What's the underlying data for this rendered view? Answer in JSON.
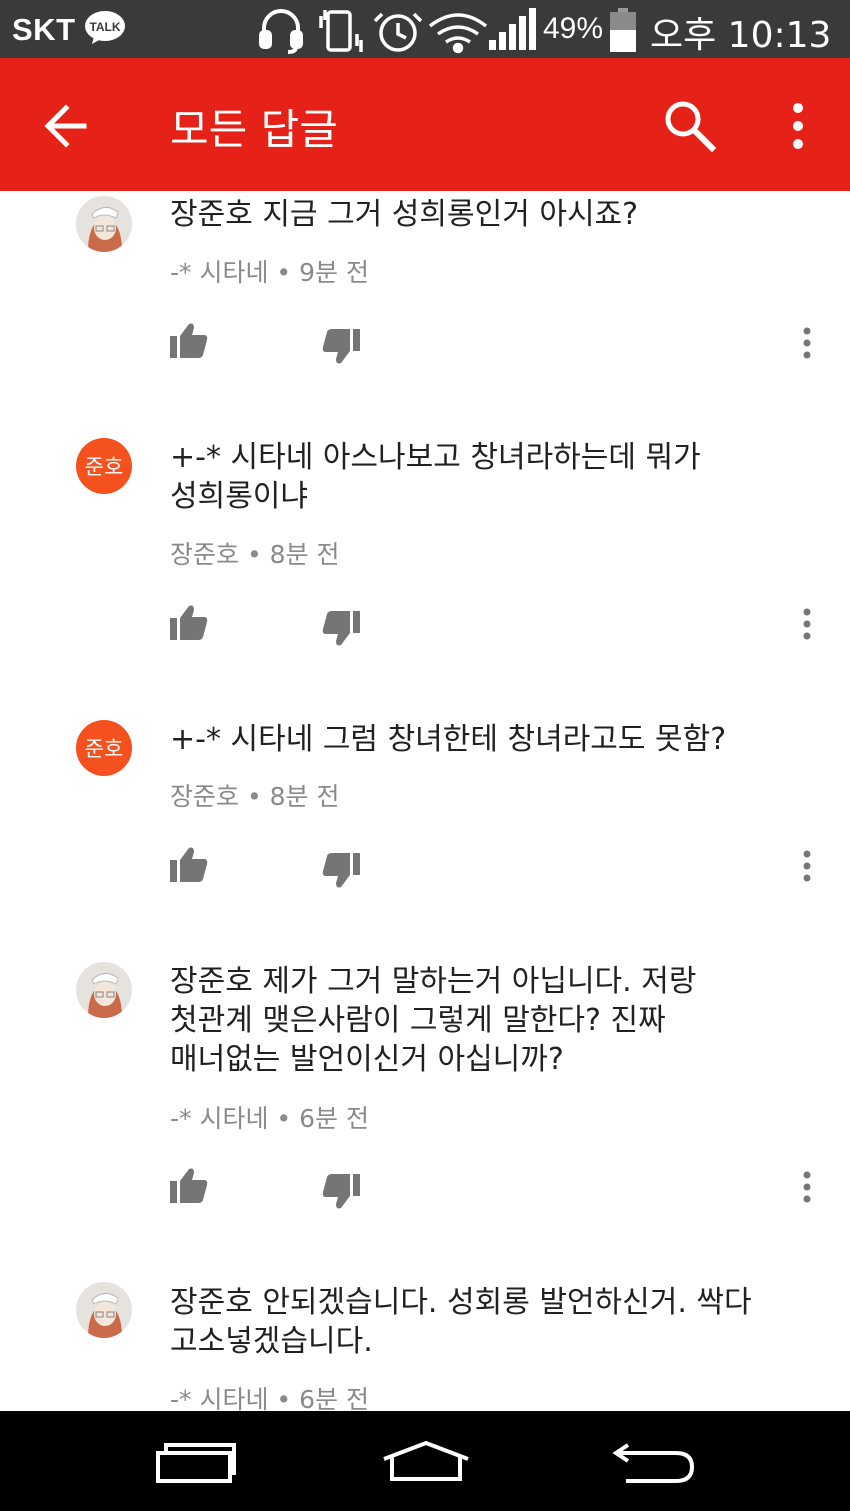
{
  "status_bar": {
    "carrier": "SKT",
    "talk_badge": "TALK",
    "battery": "49%",
    "time": "오후 10:13",
    "icons": [
      "kakaotalk-icon",
      "headset-icon",
      "vibrate-icon",
      "alarm-icon",
      "wifi-icon",
      "signal-icon",
      "battery-icon"
    ]
  },
  "app_bar": {
    "title": "모든 답글",
    "background": "#e62117",
    "icons": [
      "back-arrow-icon",
      "search-icon",
      "more-vert-icon"
    ]
  },
  "comments": [
    {
      "avatar": "avatar-image",
      "text_lines": [
        "장준호 지금 그거 성희롱인거 아시죠?"
      ],
      "meta": "-* 시타네 • 9분 전"
    },
    {
      "avatar_text": "준호",
      "text_lines": [
        "+-* 시타네 아스나보고 창녀라하는데 뭐가",
        "성희롱이냐"
      ],
      "meta": "장준호 • 8분 전"
    },
    {
      "avatar_text": "준호",
      "text_lines": [
        "+-* 시타네 그럼 창녀한테 창녀라고도 못함?"
      ],
      "meta": "장준호 • 8분 전"
    },
    {
      "avatar": "avatar-image",
      "text_lines": [
        "장준호 제가 그거 말하는거 아닙니다. 저랑",
        "첫관계 맺은사람이 그렇게 말한다? 진짜",
        "매너없는 발언이신거 아십니까?"
      ],
      "meta": "-* 시타네 • 6분 전"
    },
    {
      "avatar": "avatar-image",
      "text_lines": [
        "장준호 안되겠습니다. 성회롱 발언하신거. 싹다",
        "고소넣겠습니다."
      ],
      "meta": "-* 시타네 • 6분 전"
    }
  ],
  "colors": {
    "avatar_orange": "#f4511e",
    "text": "#212121",
    "meta": "#8a8a8a"
  },
  "nav_bar": {
    "icons": [
      "recent-apps-icon",
      "home-icon",
      "back-icon"
    ]
  }
}
